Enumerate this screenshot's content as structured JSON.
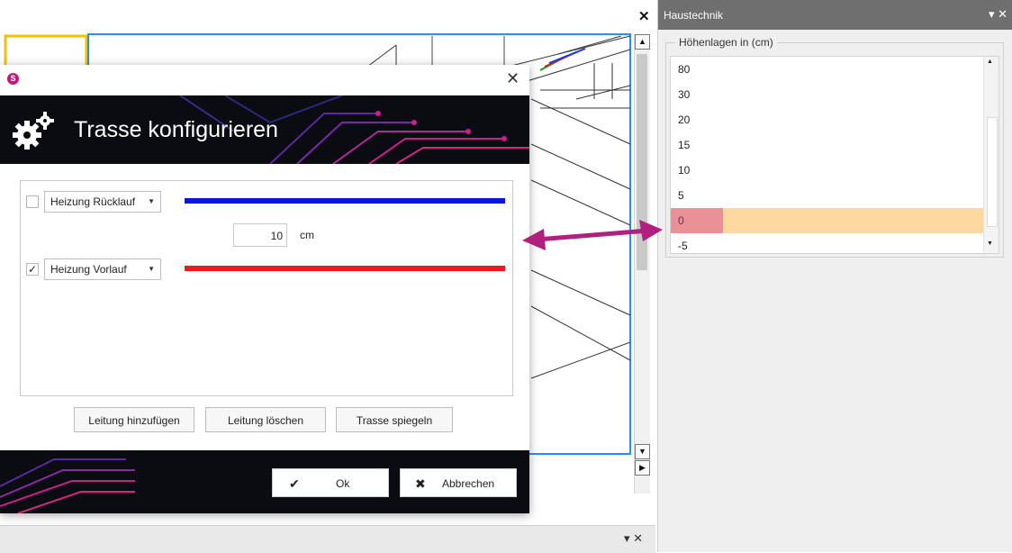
{
  "cad": {
    "bottom_controls": "▾ ✕",
    "close_symbol": "✕"
  },
  "panel": {
    "title": "Haustechnik",
    "controls": "▾ ✕",
    "group_label": "Höhenlagen in (cm)",
    "items": [
      "80",
      "30",
      "20",
      "15",
      "10",
      "5",
      "0",
      "-5"
    ],
    "selected_index": 6
  },
  "dialog": {
    "logo_letter": "S",
    "close_symbol": "✕",
    "title": "Trasse konfigurieren",
    "rows": [
      {
        "label": "Heizung Rücklauf",
        "checked": false,
        "color": "#0a14e6"
      },
      {
        "label": "Heizung Vorlauf",
        "checked": true,
        "color": "#f01818"
      }
    ],
    "spacing_value": "10",
    "spacing_unit": "cm",
    "buttons": {
      "add": "Leitung hinzufügen",
      "delete": "Leitung löschen",
      "mirror": "Trasse spiegeln"
    },
    "ok_label": "Ok",
    "cancel_label": "Abbrechen"
  },
  "icons": {
    "check": "✔",
    "cancel": "✖",
    "dropdown": "▼",
    "scroll_up": "▲",
    "scroll_down": "▼",
    "scroll_right": "▶"
  },
  "colors": {
    "highlight": "#fdd8a0",
    "arrow": "#b0207e",
    "accent_magenta": "#c2187a"
  }
}
